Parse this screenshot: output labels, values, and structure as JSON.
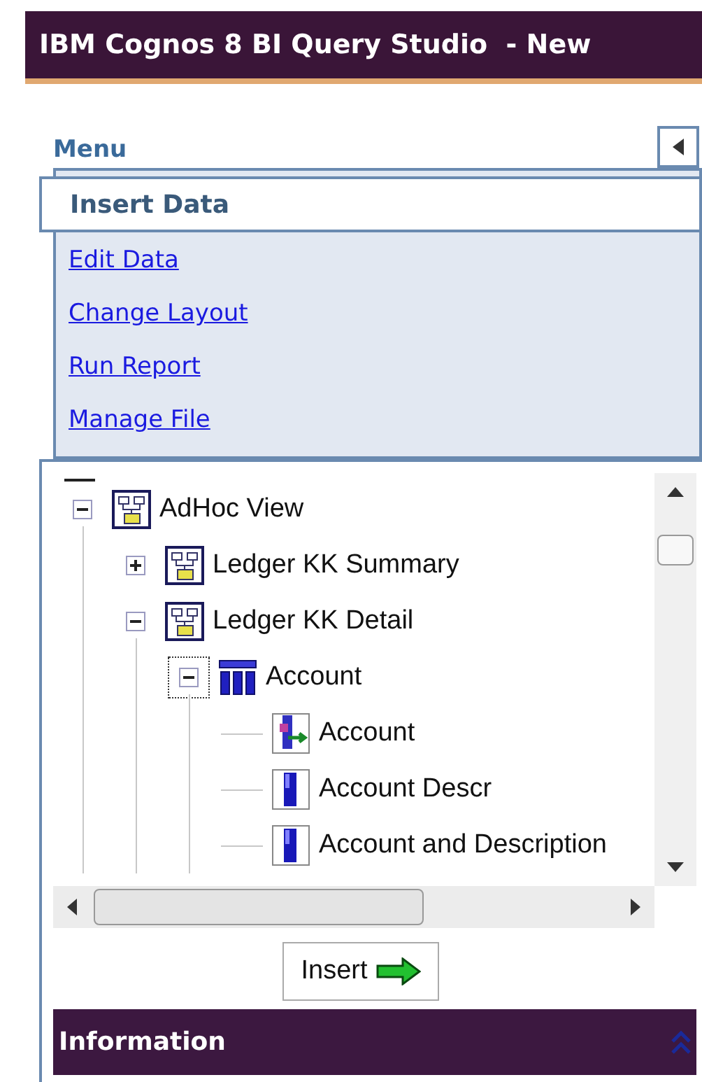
{
  "window": {
    "title": "IBM Cognos 8 BI Query Studio  - New"
  },
  "menu": {
    "title": "Menu",
    "items": [
      {
        "label": "Insert Data",
        "selected": true
      },
      {
        "label": "Edit Data",
        "selected": false
      },
      {
        "label": "Change Layout",
        "selected": false
      },
      {
        "label": "Run Report",
        "selected": false
      },
      {
        "label": "Manage File",
        "selected": false
      }
    ]
  },
  "tree": [
    {
      "label": "AdHoc View",
      "kind": "package",
      "expanded": true,
      "focused": false,
      "children": [
        {
          "label": "Ledger KK Summary",
          "kind": "package",
          "expanded": false,
          "focused": false
        },
        {
          "label": "Ledger KK Detail",
          "kind": "package",
          "expanded": true,
          "focused": false,
          "children": [
            {
              "label": "Account",
              "kind": "query-subject",
              "expanded": true,
              "focused": true,
              "children": [
                {
                  "label": "Account",
                  "kind": "key-item"
                },
                {
                  "label": "Account Descr",
                  "kind": "data-item"
                },
                {
                  "label": "Account and Description",
                  "kind": "data-item"
                }
              ]
            }
          ]
        }
      ]
    }
  ],
  "insert_button": {
    "label": "Insert"
  },
  "information_panel": {
    "title": "Information",
    "expanded": true
  }
}
